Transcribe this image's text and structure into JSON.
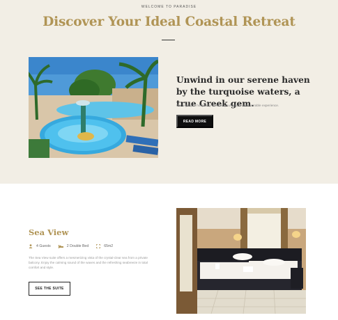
{
  "hero": {
    "eyebrow": "WELCOME TO PARADISE",
    "title": "Discover Your Ideal Coastal Retreat"
  },
  "intro": {
    "headline": "Unwind in our serene haven by the turquoise waters, a true Greek gem.",
    "subtext": "Our legacy of hospitality ensures your stay is a memorable experience.",
    "cta_label": "READ MORE"
  },
  "suite": {
    "name": "Sea View",
    "amenities": [
      {
        "icon": "guest-icon",
        "label": "4 Guests"
      },
      {
        "icon": "bed-icon",
        "label": "2 Double Bed"
      },
      {
        "icon": "area-icon",
        "label": "65m2"
      }
    ],
    "description": "The Sea View suite offers a mesmerizing vista of the crystal-clear sea from a private balcony. Enjoy the calming sound of the waves and the refreshing seabreeze in total comfort and style.",
    "cta_label": "SEE THE SUITE"
  },
  "colors": {
    "accent_gold": "#b09455",
    "hero_background": "#f2eee5",
    "button_dark": "#0f0f0f"
  }
}
